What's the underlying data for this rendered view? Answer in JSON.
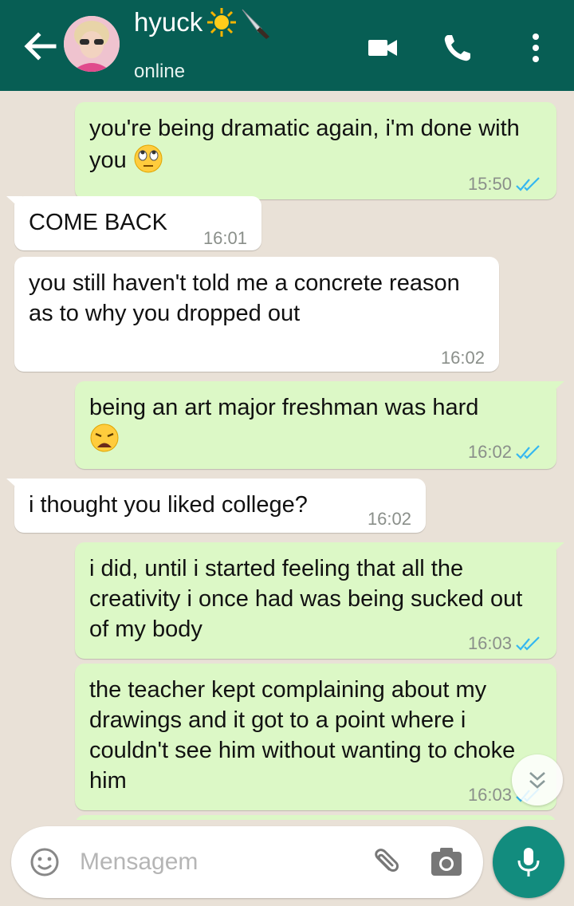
{
  "header": {
    "contact_name": "hyuck",
    "status": "online",
    "name_emojis": [
      "sun-emoji",
      "knife-emoji"
    ]
  },
  "messages": [
    {
      "direction": "out",
      "text": "you're being dramatic again, i'm done with you",
      "emoji": "face-with-rolling-eyes",
      "time": "15:50",
      "read": true
    },
    {
      "direction": "in",
      "text": "COME BACK",
      "time": "16:01"
    },
    {
      "direction": "in",
      "text": "you still haven't told me a concrete reason as to why you dropped out",
      "time": "16:02"
    },
    {
      "direction": "out",
      "text": "being an art major freshman was hard",
      "emoji": "weary-face",
      "time": "16:02",
      "read": true
    },
    {
      "direction": "in",
      "text": "i thought you liked college?",
      "time": "16:02"
    },
    {
      "direction": "out",
      "text": "i did, until i started feeling that all the creativity i once had was being sucked out of my body",
      "time": "16:03",
      "read": true
    },
    {
      "direction": "out",
      "text": "the teacher kept complaining about my drawings and it got to a point where i couldn't see him without wanting to choke him",
      "time": "16:03",
      "read": true
    }
  ],
  "composer": {
    "placeholder": "Mensagem"
  },
  "colors": {
    "header": "#075e54",
    "outgoing_bubble": "#dcf8c6",
    "incoming_bubble": "#ffffff",
    "read_ticks": "#34b7f1",
    "mic_button": "#128c7e"
  }
}
